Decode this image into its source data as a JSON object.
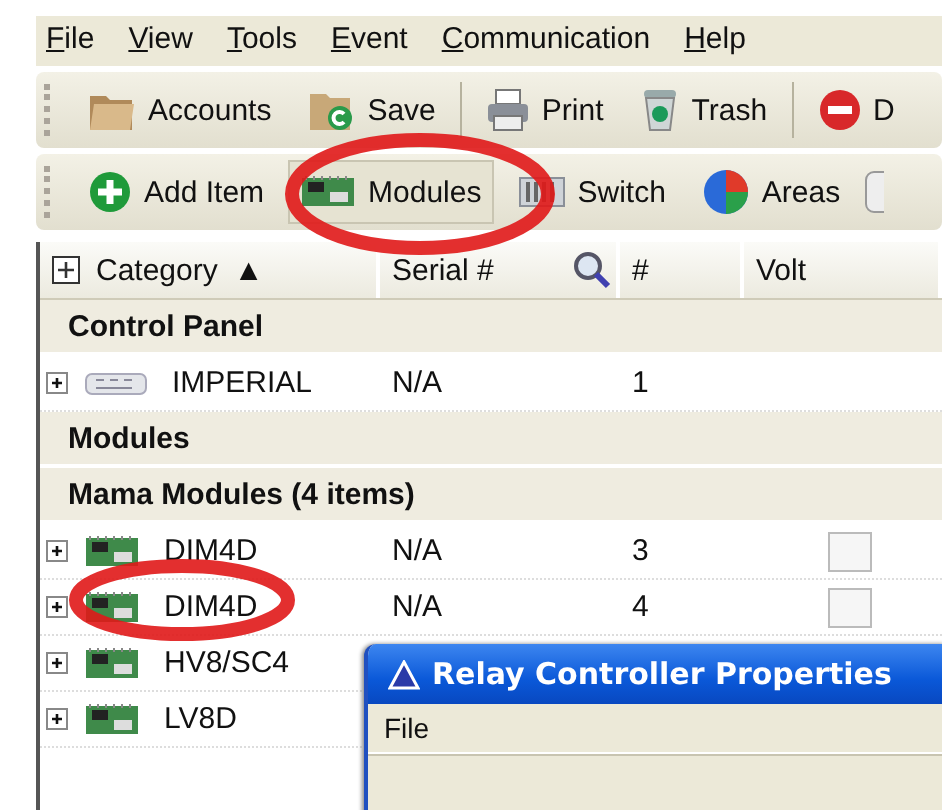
{
  "menu": [
    "File",
    "View",
    "Tools",
    "Event",
    "Communication",
    "Help"
  ],
  "toolbars": [
    {
      "items": [
        {
          "label": "Accounts",
          "kind": "folder",
          "pressed": false
        },
        {
          "label": "Save",
          "kind": "save",
          "pressed": false
        },
        {
          "kind": "separator"
        },
        {
          "label": "Print",
          "kind": "printer",
          "pressed": false
        },
        {
          "label": "Trash",
          "kind": "trash",
          "pressed": false
        },
        {
          "kind": "separator"
        },
        {
          "label": "D",
          "kind": "stop",
          "pressed": false
        }
      ]
    },
    {
      "items": [
        {
          "label": "Add Item",
          "kind": "add",
          "pressed": false
        },
        {
          "label": "Modules",
          "kind": "board",
          "pressed": true
        },
        {
          "label": "Switch",
          "kind": "keys",
          "pressed": false
        },
        {
          "label": "Areas",
          "kind": "ball",
          "pressed": false
        },
        {
          "kind": "device"
        }
      ]
    }
  ],
  "table": {
    "columns": [
      {
        "label": "Category",
        "sort_glyph": "▲"
      },
      {
        "label": "Serial #",
        "search": true
      },
      {
        "label": "#"
      },
      {
        "label": "Volt"
      }
    ],
    "rows": [
      {
        "kind": "group",
        "label": "Control Panel"
      },
      {
        "kind": "panel",
        "expanded": false,
        "name": "IMPERIAL",
        "serial": "N/A",
        "number": "1"
      },
      {
        "kind": "group",
        "label": "Modules"
      },
      {
        "kind": "group",
        "label": "Mama Modules  (4 items)"
      },
      {
        "kind": "module",
        "expanded": false,
        "name": "DIM4D",
        "serial": "N/A",
        "number": "3",
        "volt_checked": false
      },
      {
        "kind": "module",
        "expanded": false,
        "name": "DIM4D",
        "serial": "N/A",
        "number": "4",
        "volt_checked": false
      },
      {
        "kind": "module",
        "expanded": false,
        "name": "HV8/SC4"
      },
      {
        "kind": "module",
        "expanded": false,
        "name": "LV8D"
      }
    ]
  },
  "dialog": {
    "title": "Relay Controller Properties",
    "menu": [
      "File"
    ]
  }
}
